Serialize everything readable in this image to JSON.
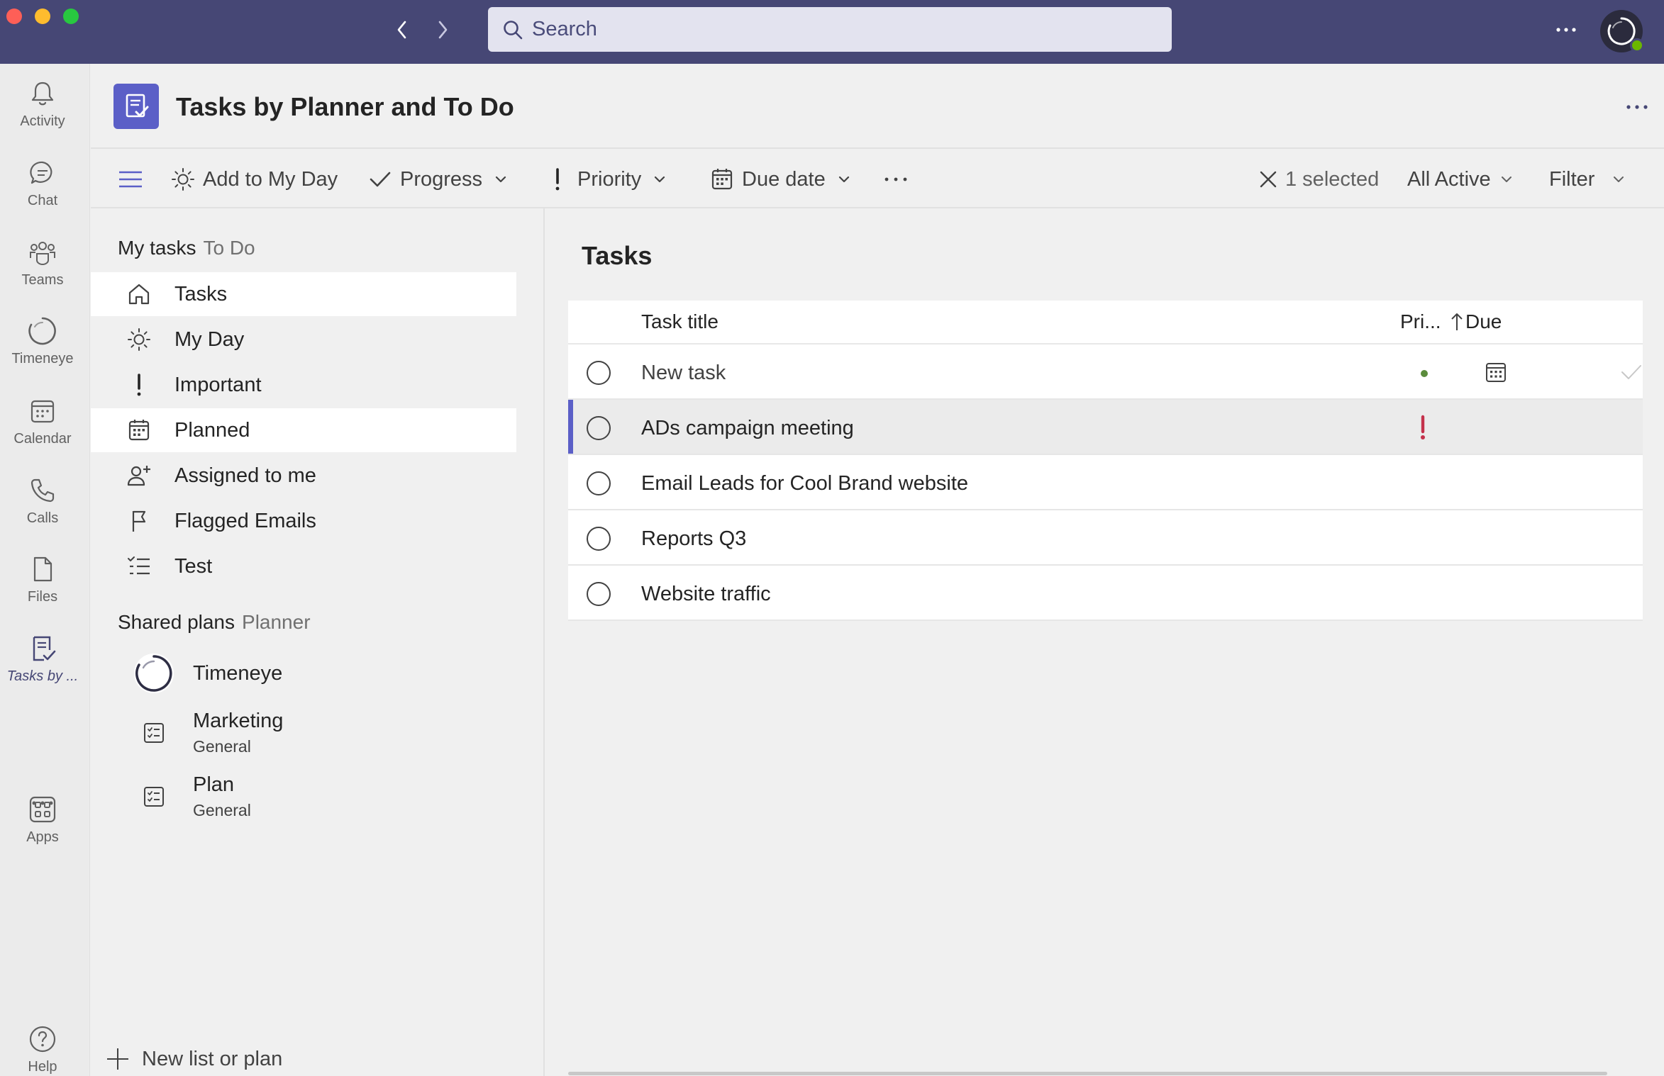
{
  "titlebar": {
    "search_placeholder": "Search"
  },
  "rail": {
    "items": [
      {
        "label": "Activity",
        "icon": "bell-icon"
      },
      {
        "label": "Chat",
        "icon": "chat-icon"
      },
      {
        "label": "Teams",
        "icon": "teams-icon"
      },
      {
        "label": "Timeneye",
        "icon": "timeneye-icon"
      },
      {
        "label": "Calendar",
        "icon": "calendar-icon"
      },
      {
        "label": "Calls",
        "icon": "phone-icon"
      },
      {
        "label": "Files",
        "icon": "file-icon"
      },
      {
        "label": "Tasks by ...",
        "icon": "tasks-icon"
      },
      {
        "label": "Apps",
        "icon": "apps-icon"
      },
      {
        "label": "Help",
        "icon": "help-icon"
      }
    ],
    "active": "Tasks by ..."
  },
  "header": {
    "title": "Tasks by Planner and To Do"
  },
  "toolbar": {
    "add_my_day": "Add to My Day",
    "progress": "Progress",
    "priority": "Priority",
    "due_date": "Due date",
    "selected": "1 selected",
    "all_active": "All Active",
    "filter": "Filter"
  },
  "sidebar": {
    "my_tasks_header": "My tasks",
    "my_tasks_sub": "To Do",
    "items": [
      {
        "label": "Tasks",
        "icon": "home-icon"
      },
      {
        "label": "My Day",
        "icon": "sun-icon"
      },
      {
        "label": "Important",
        "icon": "exclamation-icon"
      },
      {
        "label": "Planned",
        "icon": "calendar-icon"
      },
      {
        "label": "Assigned to me",
        "icon": "person-add-icon"
      },
      {
        "label": "Flagged Emails",
        "icon": "flag-icon"
      },
      {
        "label": "Test",
        "icon": "checklist-icon"
      }
    ],
    "shared_header": "Shared plans",
    "shared_sub": "Planner",
    "plans": [
      {
        "title": "Timeneye",
        "subtitle": "",
        "icon": "timeneye-icon"
      },
      {
        "title": "Marketing",
        "subtitle": "General",
        "icon": "plan-icon"
      },
      {
        "title": "Plan",
        "subtitle": "General",
        "icon": "plan-icon"
      }
    ],
    "new_list": "New list or plan"
  },
  "main": {
    "title": "Tasks",
    "columns": {
      "title": "Task title",
      "priority": "Pri...",
      "due": "Due"
    },
    "tasks": [
      {
        "title": "New task",
        "priority": "normal-dot",
        "selected": false
      },
      {
        "title": "ADs campaign meeting",
        "priority": "important",
        "selected": true
      },
      {
        "title": "Email Leads for Cool Brand website",
        "priority": "",
        "selected": false
      },
      {
        "title": "Reports Q3",
        "priority": "",
        "selected": false
      },
      {
        "title": "Website traffic",
        "priority": "",
        "selected": false
      }
    ]
  },
  "colors": {
    "titlebar": "#464775",
    "accent": "#5b5fc7",
    "important": "#c4314b",
    "presence": "#6bb700"
  }
}
